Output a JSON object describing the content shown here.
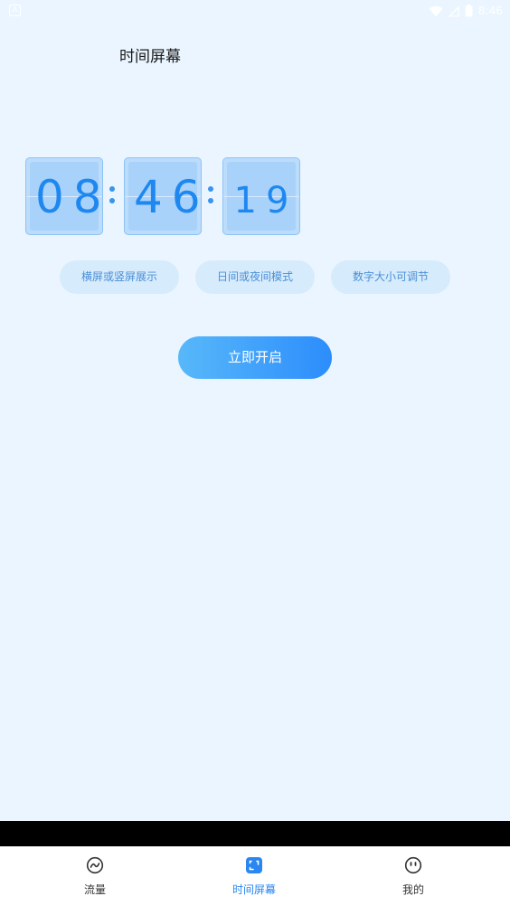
{
  "status_bar": {
    "time": "8:46"
  },
  "page": {
    "title": "时间屏幕"
  },
  "clock": {
    "hours": "08",
    "minutes": "46",
    "seconds": "19",
    "digit_color": "#1e88f0"
  },
  "features": [
    {
      "label": "横屏或竖屏展示"
    },
    {
      "label": "日间或夜间模式"
    },
    {
      "label": "数字大小可调节"
    }
  ],
  "start_button": {
    "label": "立即开启"
  },
  "bottom_nav": {
    "items": [
      {
        "label": "流量",
        "icon": "traffic-icon",
        "active": false
      },
      {
        "label": "时间屏幕",
        "icon": "time-screen-icon",
        "active": true
      },
      {
        "label": "我的",
        "icon": "profile-icon",
        "active": false
      }
    ],
    "active_color": "#2a86f0"
  }
}
